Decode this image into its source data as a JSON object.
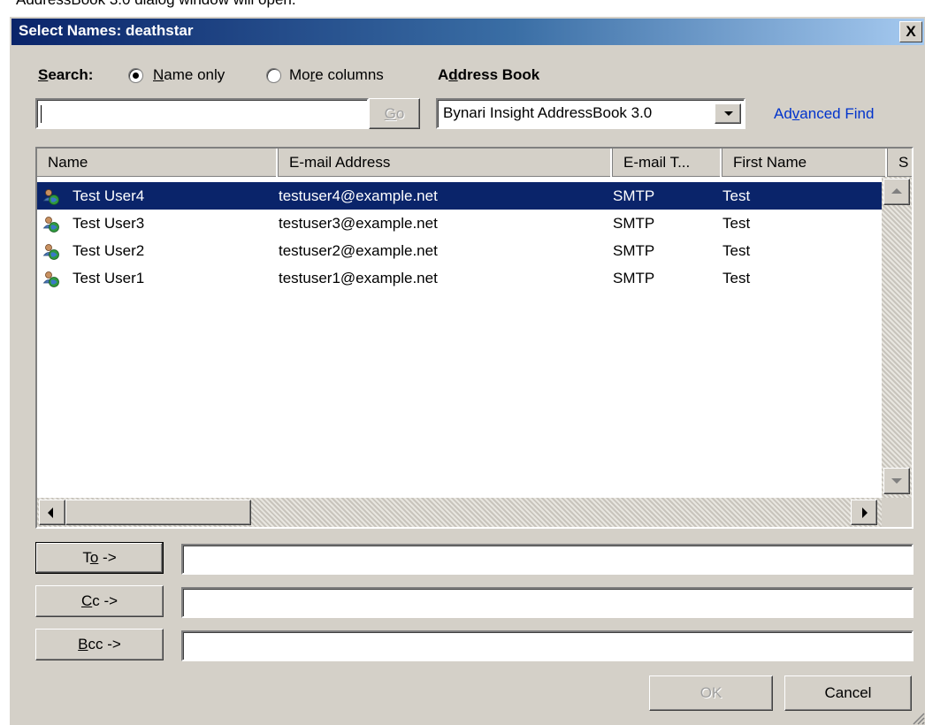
{
  "caption": "AddressBook 3.0 dialog window will open.",
  "window": {
    "title": "Select Names: deathstar",
    "close_glyph": "X"
  },
  "search": {
    "label": "Search:",
    "option_name_only": "Name only",
    "option_more_columns": "More columns",
    "selected": "Name only",
    "input_value": "",
    "go_label": "Go"
  },
  "address_book": {
    "label": "Address Book",
    "selected": "Bynari Insight AddressBook 3.0",
    "advanced_find": "Advanced Find"
  },
  "table": {
    "columns": [
      "Name",
      "E-mail Address",
      "E-mail T...",
      "First Name",
      "S"
    ],
    "rows": [
      {
        "name": "Test User4",
        "email": "testuser4@example.net",
        "type": "SMTP",
        "first": "Test",
        "selected": true
      },
      {
        "name": "Test User3",
        "email": "testuser3@example.net",
        "type": "SMTP",
        "first": "Test",
        "selected": false
      },
      {
        "name": "Test User2",
        "email": "testuser2@example.net",
        "type": "SMTP",
        "first": "Test",
        "selected": false
      },
      {
        "name": "Test User1",
        "email": "testuser1@example.net",
        "type": "SMTP",
        "first": "Test",
        "selected": false
      }
    ]
  },
  "recipients": {
    "to_label": "To ->",
    "cc_label": "Cc ->",
    "bcc_label": "Bcc ->",
    "to_value": "",
    "cc_value": "",
    "bcc_value": ""
  },
  "buttons": {
    "ok": "OK",
    "cancel": "Cancel"
  },
  "colors": {
    "selection": "#0a246a",
    "face": "#d4d0c8",
    "link": "#0033cc"
  }
}
